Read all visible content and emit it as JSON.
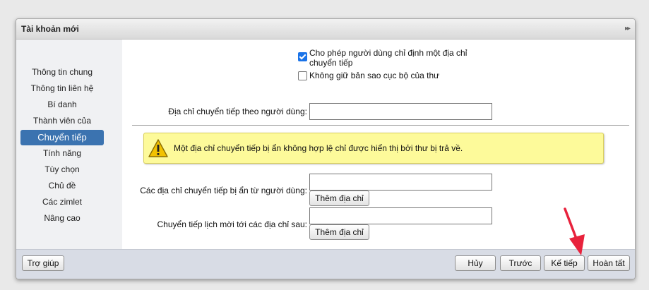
{
  "dialog": {
    "title": "Tài khoản mới",
    "collapse_glyph": "▸▸"
  },
  "sidebar": {
    "items": [
      {
        "label": "Thông tin chung"
      },
      {
        "label": "Thông tin liên hệ"
      },
      {
        "label": "Bí danh"
      },
      {
        "label": "Thành viên của"
      },
      {
        "label": "Chuyển tiếp",
        "active": true
      },
      {
        "label": "Tính năng"
      },
      {
        "label": "Tùy chọn"
      },
      {
        "label": "Chủ đề"
      },
      {
        "label": "Các zimlet"
      },
      {
        "label": "Nâng cao"
      }
    ]
  },
  "forwarding": {
    "allow_user_forward": {
      "label": "Cho phép người dùng chỉ định một địa chỉ chuyển tiếp",
      "line1": "Cho phép người dùng chỉ định một địa chỉ",
      "line2": "chuyển tiếp",
      "checked": true
    },
    "no_local_copy": {
      "label": "Không giữ bản sao cục bộ của thư",
      "checked": false
    },
    "user_forward_address": {
      "label": "Địa chỉ chuyển tiếp theo người dùng:",
      "value": ""
    },
    "warning": "Một địa chỉ chuyển tiếp bị ẩn không hợp lệ chỉ được hiển thị bởi thư bị trả về.",
    "hidden_forward": {
      "label": "Các địa chỉ chuyển tiếp bị ẩn từ người dùng:",
      "value": "",
      "add_label": "Thêm địa chỉ"
    },
    "calendar_forward": {
      "label": "Chuyển tiếp lịch mời tới các địa chỉ sau:",
      "value": "",
      "add_label": "Thêm địa chỉ"
    }
  },
  "footer": {
    "help": "Trợ giúp",
    "cancel": "Hủy",
    "previous": "Trước",
    "next": "Kế tiếp",
    "finish": "Hoàn tất"
  },
  "colors": {
    "accent": "#3b73b0",
    "warning_bg": "#fdfa9a",
    "annotation_arrow": "#e8223c"
  }
}
